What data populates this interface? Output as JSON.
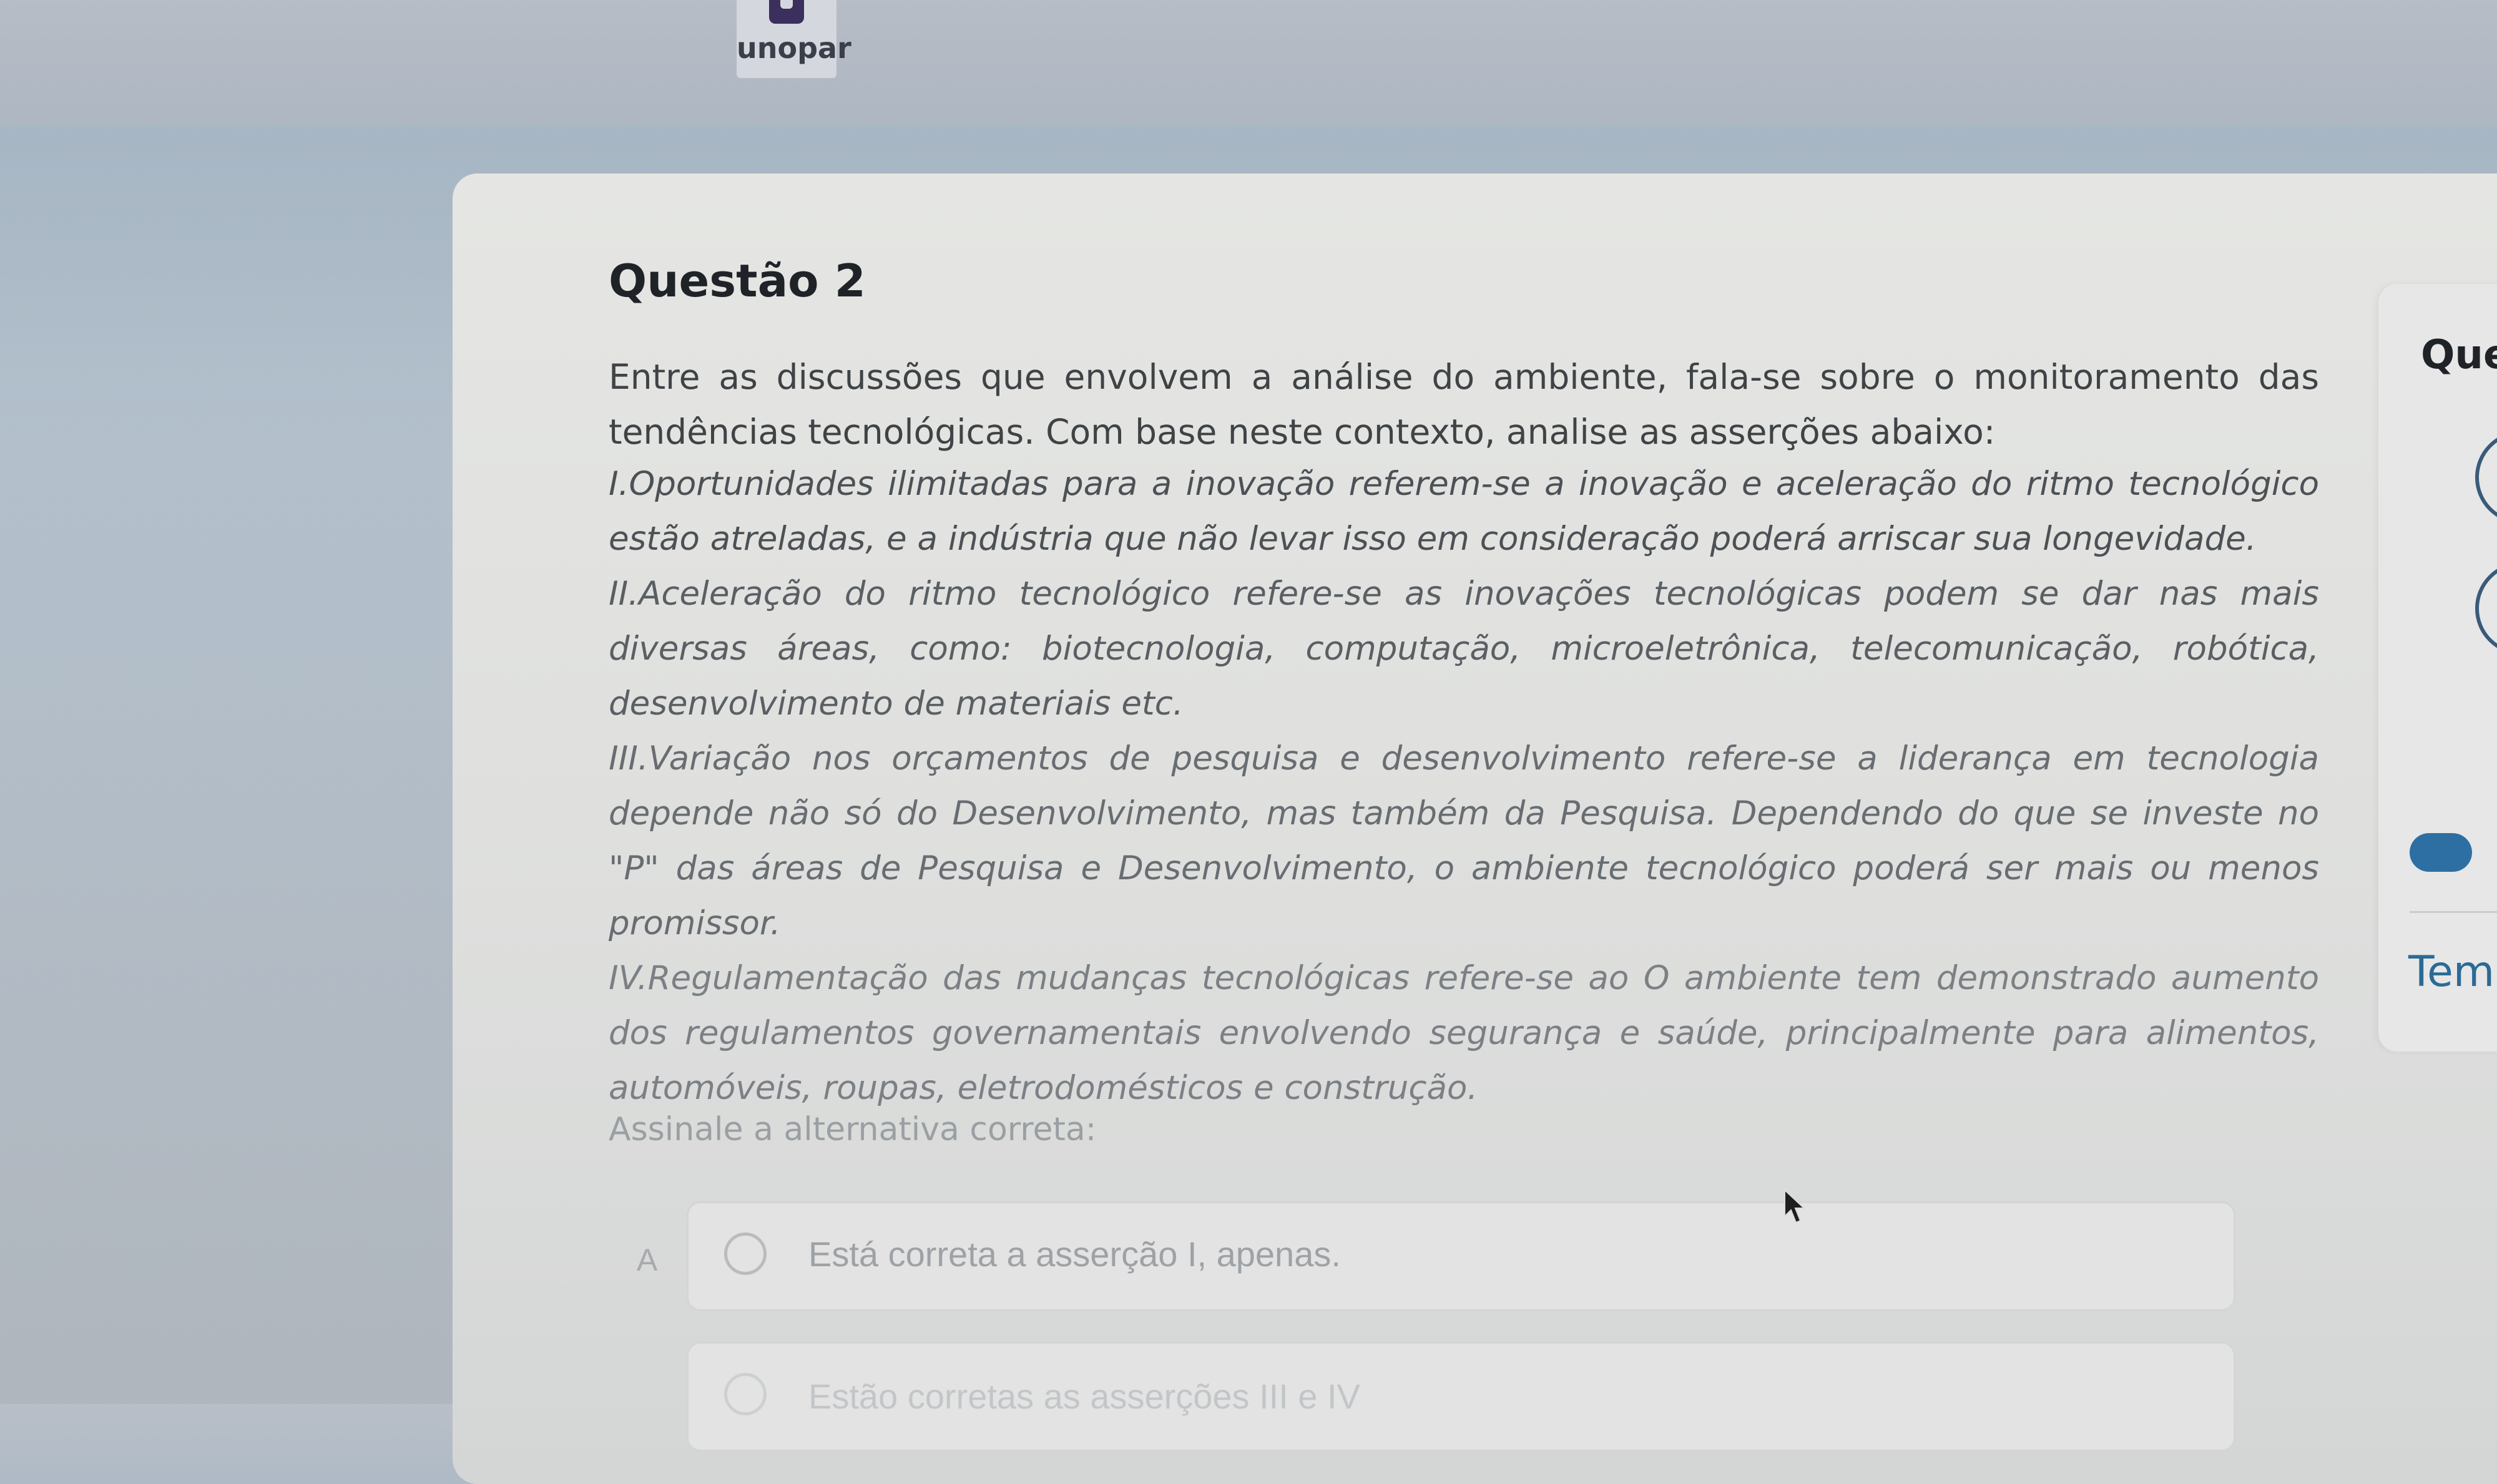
{
  "brand": {
    "name": "unopar"
  },
  "question": {
    "title": "Questão 2",
    "intro": "Entre as discussões que envolvem a análise do ambiente, fala-se sobre o monitoramento das tendências tecnológicas. Com base neste contexto, analise as asserções abaixo:",
    "assertions": [
      "I.Oportunidades ilimitadas para a inovação referem-se a inovação e aceleração do ritmo tecnológico estão atreladas, e a indústria que não levar isso em consideração poderá arriscar sua longevidade.",
      "II.Aceleração do ritmo tecnológico refere-se as inovações tecnológicas podem se dar nas mais diversas áreas, como: biotecnologia, computação, microeletrônica, telecomunicação, robótica, desenvolvimento de materiais etc.",
      "III.Variação nos orçamentos de pesquisa e desenvolvimento refere-se a liderança em tecnologia depende não só do Desenvolvimento, mas também da Pesquisa. Dependendo do que se investe no \"P\" das áreas de Pesquisa e Desenvolvimento, o ambiente tecnológico poderá ser mais ou menos promissor.",
      "IV.Regulamentação das mudanças tecnológicas refere-se ao O ambiente tem demonstrado aumento dos regulamentos governamentais envolvendo segurança e saúde, principalmente para alimentos, automóveis, roupas, eletrodomésticos e construção."
    ],
    "prompt": "Assinale a alternativa correta:",
    "options": [
      {
        "letter": "A",
        "text": "Está correta a asserção I, apenas."
      },
      {
        "letter": "",
        "text": "Estão corretas as asserções III e IV"
      }
    ]
  },
  "side_panel": {
    "title": "Ques",
    "time_label": "Temp"
  },
  "colors": {
    "accent": "#2d6fa3",
    "logo": "#3b2f5e"
  }
}
